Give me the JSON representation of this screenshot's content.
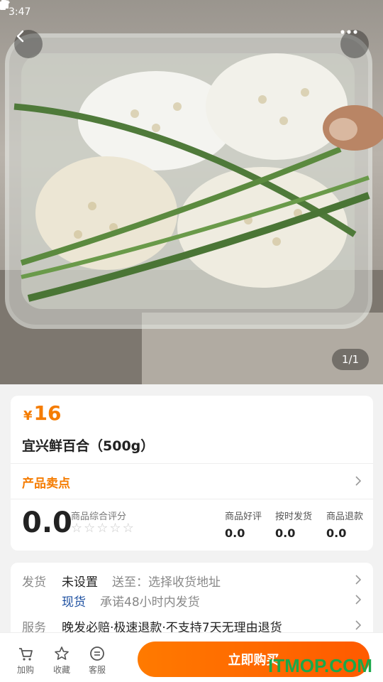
{
  "status_bar": {
    "time": "3:47"
  },
  "gallery": {
    "counter": "1/1"
  },
  "product": {
    "price_symbol": "¥",
    "price": "16",
    "title": "宜兴鲜百合（500g）",
    "selling_points_label": "产品卖点"
  },
  "rating": {
    "score": "0.0",
    "caption": "商品综合评分",
    "stars_filled": 0,
    "stars_total": 5,
    "metrics": [
      {
        "label": "商品好评",
        "value": "0.0"
      },
      {
        "label": "按时发货",
        "value": "0.0"
      },
      {
        "label": "商品退款",
        "value": "0.0"
      }
    ]
  },
  "shipping": {
    "label": "发货",
    "value": "未设置",
    "to_text": "送至：选择收货地址",
    "stock": "现货",
    "promise": "承诺48小时内发货",
    "service_label": "服务",
    "service_text": "晚发必赔·极速退款·不支持7天无理由退货"
  },
  "bottom_bar": {
    "cart": "加购",
    "favorite": "收藏",
    "service": "客服",
    "buy_now": "立即购买"
  },
  "watermark": "ITMOP.COM",
  "colors": {
    "accent": "#f57c00",
    "buy_button": "#ff6a00",
    "link_blue": "#1c4fa0"
  }
}
